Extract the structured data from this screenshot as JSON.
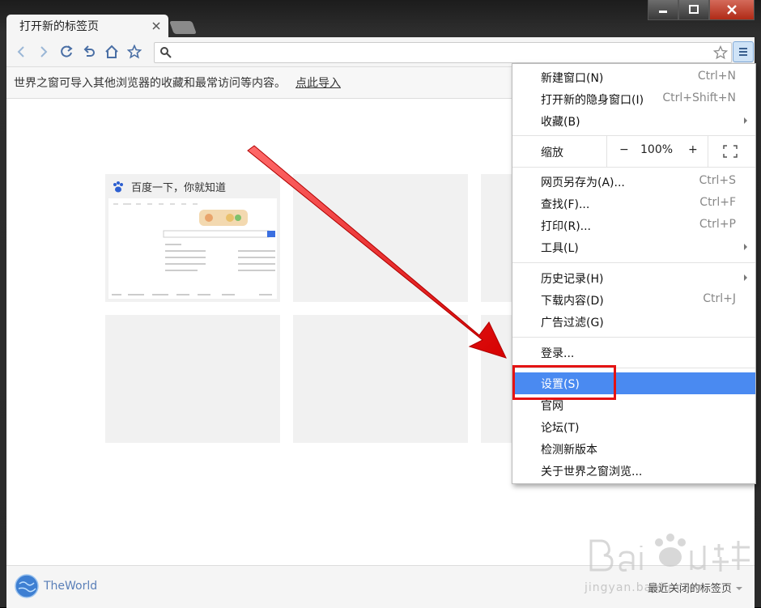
{
  "window": {
    "tab_title": "打开新的标签页"
  },
  "infobar": {
    "message": "世界之窗可导入其他浏览器的收藏和最常访问等内容。",
    "link": "点此导入"
  },
  "tiles": [
    {
      "title": "百度一下，你就知道",
      "icon": "baidu-paw-icon"
    }
  ],
  "menu": {
    "items": [
      {
        "label": "新建窗口(N)",
        "shortcut": "Ctrl+N"
      },
      {
        "label": "打开新的隐身窗口(I)",
        "shortcut": "Ctrl+Shift+N"
      },
      {
        "label": "收藏(B)",
        "shortcut": ""
      },
      {
        "label": "网页另存为(A)...",
        "shortcut": "Ctrl+S"
      },
      {
        "label": "查找(F)...",
        "shortcut": "Ctrl+F"
      },
      {
        "label": "打印(R)...",
        "shortcut": "Ctrl+P"
      },
      {
        "label": "工具(L)",
        "shortcut": ""
      },
      {
        "label": "历史记录(H)",
        "shortcut": ""
      },
      {
        "label": "下载内容(D)",
        "shortcut": "Ctrl+J"
      },
      {
        "label": "广告过滤(G)",
        "shortcut": ""
      },
      {
        "label": "登录...",
        "shortcut": ""
      },
      {
        "label": "设置(S)",
        "shortcut": ""
      },
      {
        "label": "官网",
        "shortcut": ""
      },
      {
        "label": "论坛(T)",
        "shortcut": ""
      },
      {
        "label": "检测新版本",
        "shortcut": ""
      },
      {
        "label": "关于世界之窗浏览...",
        "shortcut": ""
      }
    ],
    "zoom": {
      "label": "缩放",
      "minus": "−",
      "value": "100%",
      "plus": "+"
    },
    "highlighted": "设置(S)"
  },
  "bottombar": {
    "brand": "TheWorld",
    "recent": "最近关闭的标签页"
  },
  "watermark": {
    "text": "jingyan.baidu.com",
    "logo": "Baidu 经验"
  },
  "colors": {
    "highlight": "#4a8af1",
    "annotation": "#e41313",
    "brand": "#5a7fb8"
  }
}
